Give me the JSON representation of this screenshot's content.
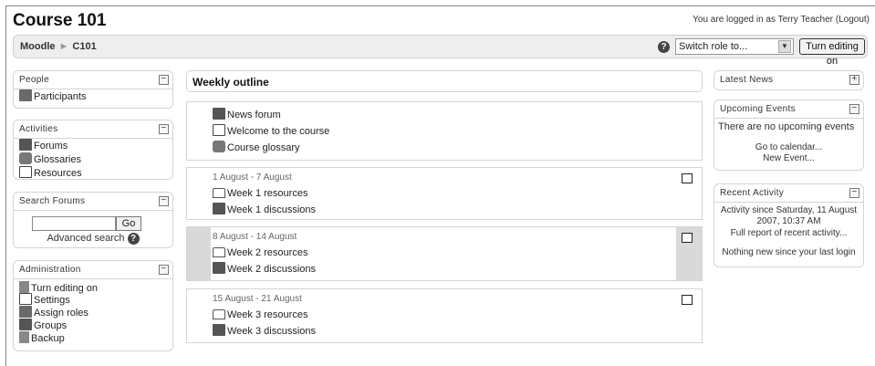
{
  "page": {
    "title": "Course 101",
    "login_info": "You are logged in as Terry Teacher (Logout)"
  },
  "navbar": {
    "crumb_home": "Moodle",
    "crumb_sep": "►",
    "crumb_course": "C101",
    "help": "?",
    "role_select_value": "Switch role to...",
    "role_arrow": "▼",
    "editing_button": "Turn editing on"
  },
  "left": {
    "people": {
      "title": "People",
      "toggle": "−",
      "items": [
        "Participants"
      ]
    },
    "activities": {
      "title": "Activities",
      "toggle": "−",
      "items": [
        "Forums",
        "Glossaries",
        "Resources"
      ]
    },
    "search": {
      "title": "Search Forums",
      "toggle": "−",
      "go_label": "Go",
      "advanced": "Advanced search",
      "help": "?"
    },
    "admin": {
      "title": "Administration",
      "toggle": "−",
      "items": [
        "Turn editing on",
        "Settings",
        "Assign roles",
        "Groups",
        "Backup"
      ]
    }
  },
  "center": {
    "heading": "Weekly outline",
    "section0": {
      "items": [
        "News forum",
        "Welcome to the course",
        "Course glossary"
      ]
    },
    "weeks": [
      {
        "date": "1 August - 7 August",
        "items": [
          "Week 1 resources",
          "Week 1 discussions"
        ]
      },
      {
        "date": "8 August - 14 August",
        "items": [
          "Week 2 resources",
          "Week 2 discussions"
        ]
      },
      {
        "date": "15 August - 21 August",
        "items": [
          "Week 3 resources",
          "Week 3 discussions"
        ]
      }
    ]
  },
  "right": {
    "news": {
      "title": "Latest News",
      "toggle": "+"
    },
    "events": {
      "title": "Upcoming Events",
      "toggle": "−",
      "text": "There are no upcoming events",
      "link1": "Go to calendar...",
      "link2": "New Event..."
    },
    "activity": {
      "title": "Recent Activity",
      "toggle": "−",
      "since": "Activity since Saturday, 11 August 2007, 10:37 AM",
      "report": "Full report of recent activity...",
      "nothing": "Nothing new since your last login"
    }
  }
}
